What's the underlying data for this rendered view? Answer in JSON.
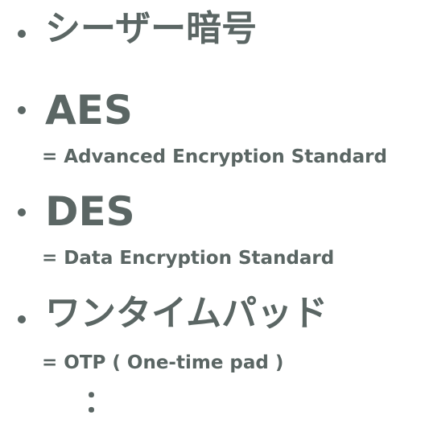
{
  "items": [
    {
      "title": "シーザー暗号",
      "subtitle": ""
    },
    {
      "title": "AES",
      "subtitle": "= Advanced Encryption Standard"
    },
    {
      "title": "DES",
      "subtitle": "= Data Encryption Standard"
    },
    {
      "title": "ワンタイムパッド",
      "subtitle": "= OTP ( One-time pad )"
    }
  ],
  "continuation": "："
}
